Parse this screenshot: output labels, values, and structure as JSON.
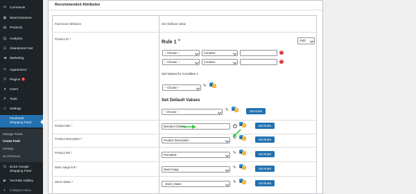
{
  "sidebar": {
    "items": [
      {
        "label": "Comments",
        "icon": "speech-bubble-icon"
      },
      {
        "label": "WooCommerce",
        "icon": "woo-icon"
      },
      {
        "label": "Products",
        "icon": "box-icon"
      },
      {
        "label": "Analytics",
        "icon": "bar-chart-icon"
      },
      {
        "label": "Abandoned Cart",
        "icon": "cart-icon"
      },
      {
        "label": "Marketing",
        "icon": "megaphone-icon"
      },
      {
        "label": "Appearance",
        "icon": "brush-icon"
      },
      {
        "label": "Plugins",
        "icon": "plug-icon",
        "badge": "9"
      },
      {
        "label": "Users",
        "icon": "user-icon"
      },
      {
        "label": "Tools",
        "icon": "wrench-icon"
      },
      {
        "label": "Settings",
        "icon": "sliders-icon"
      },
      {
        "label": "Facebook Shopping Feed",
        "icon": "facebook-icon",
        "active": true
      },
      {
        "label": "ELEX Google Shopping Feed",
        "icon": "google-icon"
      },
      {
        "label": "YouTube Gallery",
        "icon": "play-icon"
      },
      {
        "label": "Collapse menu",
        "icon": "collapse-icon"
      }
    ],
    "submenu": [
      "Manage Feeds",
      "Create Feed",
      "Settings",
      "Go Premium!"
    ],
    "current_submenu": "Create Feed"
  },
  "panel": {
    "title": "Recommended Attributes",
    "col_attr": "Facebook Attributes",
    "col_value": "Set Attribute Value"
  },
  "rows": {
    "product_id": "Product ID *",
    "product_title": "Product title *",
    "product_description": "Product description *",
    "product_link": "Product link *",
    "main_image_link": "Main image link *",
    "stock_status": "Stock status *"
  },
  "rule": {
    "title": "Rule 1",
    "sup": "⚙",
    "and_value": "AND",
    "choose": "-- Choose --",
    "contains": "Contains",
    "set_values_heading": "Set Values for Condition 1",
    "default_heading": "Set Default Values"
  },
  "values": {
    "title_input": "Branded Clothing",
    "description_select": "Product Description",
    "link_select": "Permalink",
    "image_select": "Main Image",
    "stock_select": "_stock_status"
  },
  "buttons": {
    "set_rules": "Set Rules"
  },
  "colors": {
    "sidebar_bg": "#1d2327",
    "accent": "#2271b1",
    "remove": "#d63638",
    "annotation_arrow": "#3cc43c"
  }
}
